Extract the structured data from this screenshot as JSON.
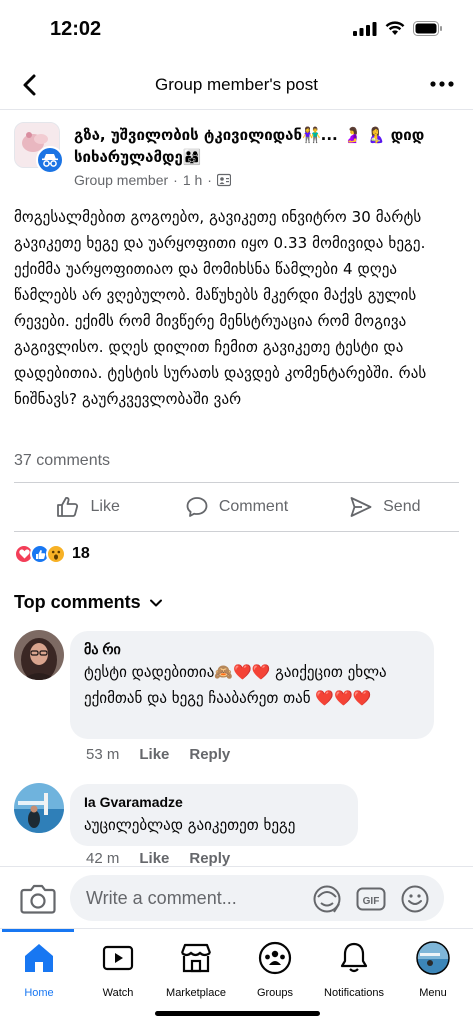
{
  "status_bar": {
    "time": "12:02"
  },
  "nav": {
    "title": "Group member's post"
  },
  "post": {
    "group_name": "გზა, უშვილობის ტკივილიდან👫... 🤰 🤱 დიდ სიხარულამდე👨‍👩‍👧",
    "role": "Group member",
    "time": "1 h",
    "body": "მოგესალმებით გოგოებო, გავიკეთე ინვიტრო 30 მარტს გავიკეთე ხეგე და უარყოფითი იყო 0.33 მომივიდა ხეგე. ექიმმა უარყოფითიაო და მომიხსნა წამლები 4 დღეა წამლებს არ ვღებულობ. მაწუხებს მკერდი მაქვს გულის რევები. ექიმს რომ მივწერე მენსტრუაცია რომ მოგივა გაგივლისო. დღეს დილით ჩემით გავიკეთე ტესტი და დადებითია. ტესტის სურათს დავდებ კომენტარებში. რას ნიშნავს? გაურკვევლობაში ვარ",
    "comments_count": "37 comments",
    "actions": {
      "like": "Like",
      "comment": "Comment",
      "send": "Send"
    },
    "reaction_count": "18"
  },
  "top_comments_label": "Top comments",
  "comments": [
    {
      "author": "მა რი",
      "text": "ტესტი დადებითია🙈❤️❤️ გაიქეცით ეხლა ექიმთან და ხეგე ჩააბარეთ თან ❤️❤️❤️",
      "time": "53 m",
      "like": "Like",
      "reply": "Reply"
    },
    {
      "author": "Ia Gvaramadze",
      "text": "აუცილებლად გაიკეთეთ ხეგე",
      "time": "42 m",
      "like": "Like",
      "reply": "Reply"
    }
  ],
  "composer": {
    "placeholder": "Write a comment..."
  },
  "tabs": [
    {
      "label": "Home",
      "icon": "home-icon"
    },
    {
      "label": "Watch",
      "icon": "watch-icon"
    },
    {
      "label": "Marketplace",
      "icon": "marketplace-icon"
    },
    {
      "label": "Groups",
      "icon": "groups-icon"
    },
    {
      "label": "Notifications",
      "icon": "bell-icon"
    },
    {
      "label": "Menu",
      "icon": "profile-avatar"
    }
  ],
  "colors": {
    "accent": "#1877f2",
    "secondary_text": "#65676b",
    "bubble": "#f0f2f5",
    "love": "#f33e58",
    "like": "#1877f2",
    "wow": "#f7b125"
  }
}
